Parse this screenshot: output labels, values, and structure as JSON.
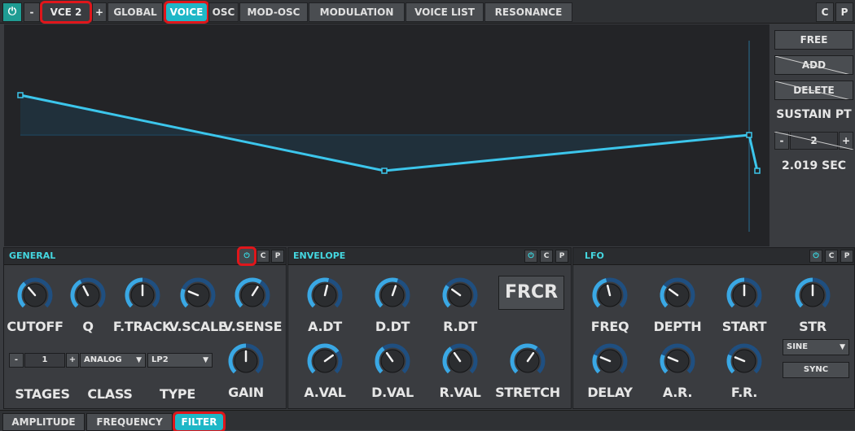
{
  "topbar": {
    "power_icon": "power-icon",
    "minus": "-",
    "voice_name": "VCE 2",
    "plus": "+",
    "tabs": [
      "GLOBAL",
      "VOICE",
      "OSC",
      "MOD-OSC",
      "MODULATION",
      "VOICE LIST",
      "RESONANCE"
    ],
    "active_tab": "VOICE",
    "copy": "C",
    "paste": "P"
  },
  "envelope_editor": {
    "free_label": "FREE",
    "add_label": "ADD",
    "delete_label": "DELETE",
    "sustain_label": "SUSTAIN PT",
    "sustain_minus": "-",
    "sustain_value": "2",
    "sustain_plus": "+",
    "time_readout": "2.019  SEC",
    "line_color": "#3cc6ec"
  },
  "general": {
    "title": "GENERAL",
    "copy": "C",
    "paste": "P",
    "knobs": [
      {
        "label": "CUTOFF",
        "value": 0.35
      },
      {
        "label": "Q",
        "value": 0.4
      },
      {
        "label": "F.TRACK",
        "value": 0.5
      },
      {
        "label": "V.SCALE",
        "value": 0.25
      },
      {
        "label": "V.SENSE",
        "value": 0.62
      },
      {
        "label": "GAIN",
        "value": 0.5
      }
    ],
    "stages_minus": "-",
    "stages_value": "1",
    "stages_plus": "+",
    "class_value": "ANALOG",
    "type_value": "LP2",
    "stages_label": "STAGES",
    "class_label": "CLASS",
    "type_label": "TYPE"
  },
  "envelope": {
    "title": "ENVELOPE",
    "copy": "C",
    "paste": "P",
    "knobs": [
      {
        "label": "A.DT",
        "value": 0.55
      },
      {
        "label": "D.DT",
        "value": 0.57
      },
      {
        "label": "R.DT",
        "value": 0.3
      },
      {
        "label": "A.VAL",
        "value": 0.7
      },
      {
        "label": "D.VAL",
        "value": 0.37
      },
      {
        "label": "R.VAL",
        "value": 0.37
      },
      {
        "label": "STRETCH",
        "value": 0.63
      }
    ],
    "frcr_label": "FRCR"
  },
  "lfo": {
    "title": "LFO",
    "copy": "C",
    "paste": "P",
    "knobs": [
      {
        "label": "FREQ",
        "value": 0.45
      },
      {
        "label": "DEPTH",
        "value": 0.3
      },
      {
        "label": "START",
        "value": 0.5
      },
      {
        "label": "STR",
        "value": 0.5
      },
      {
        "label": "DELAY",
        "value": 0.25
      },
      {
        "label": "A.R.",
        "value": 0.25
      },
      {
        "label": "F.R.",
        "value": 0.25
      }
    ],
    "shape_value": "SINE",
    "sync_label": "SYNC"
  },
  "bottom_tabs": [
    "AMPLITUDE",
    "FREQUENCY",
    "FILTER"
  ],
  "active_bottom_tab": "FILTER"
}
